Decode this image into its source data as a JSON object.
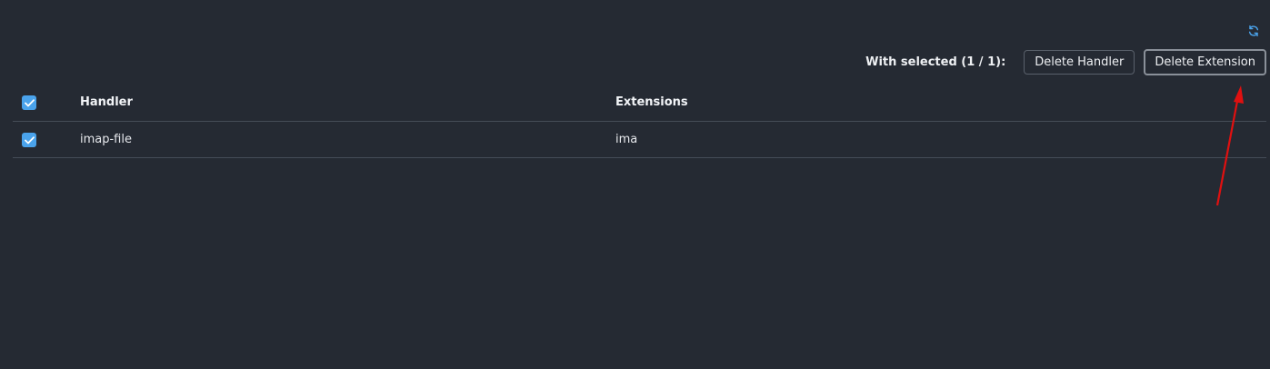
{
  "toolbar": {
    "refresh_icon": "refresh-icon",
    "with_selected_label": "With selected (1 / 1):",
    "delete_handler_label": "Delete Handler",
    "delete_extension_label": "Delete Extension"
  },
  "table": {
    "columns": [
      "Handler",
      "Extensions"
    ],
    "rows": [
      {
        "handler": "imap-file",
        "extensions": "ima",
        "selected": true
      }
    ],
    "select_all": true
  },
  "colors": {
    "background": "#252a33",
    "checkbox": "#4aa3ec",
    "annotation_arrow": "#e01010"
  }
}
